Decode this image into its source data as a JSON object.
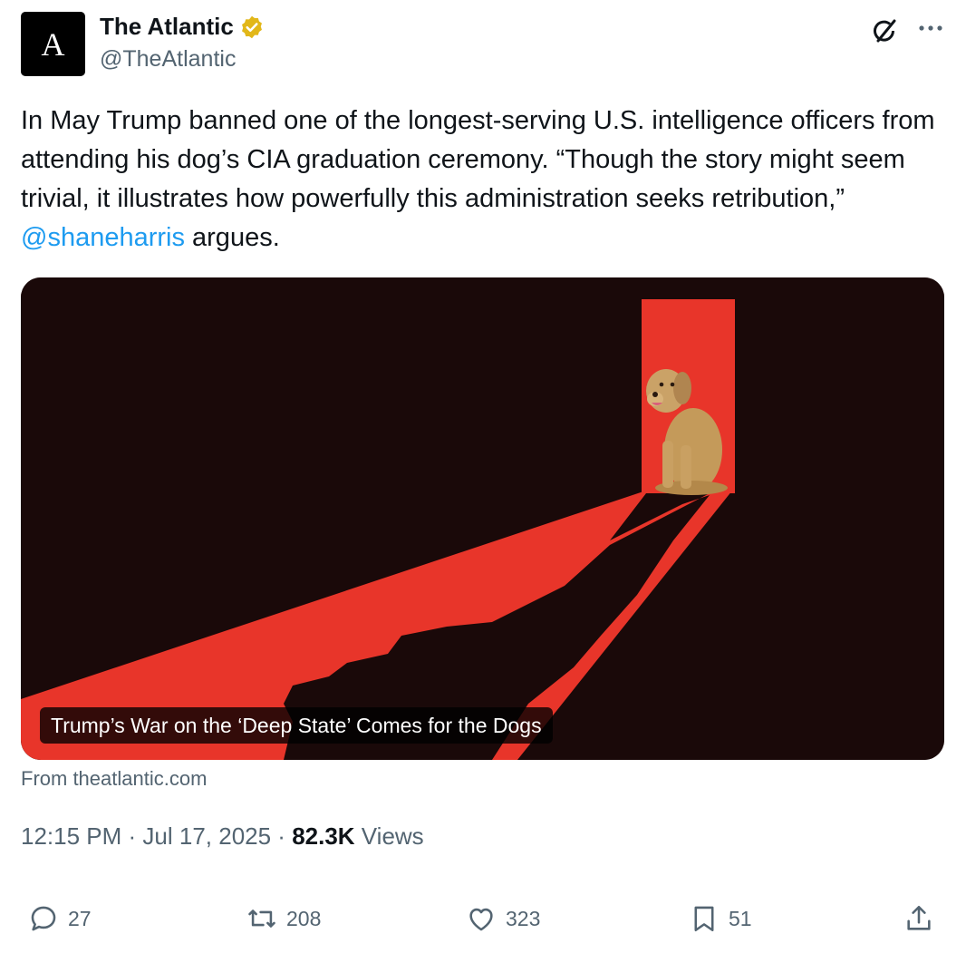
{
  "author": {
    "avatar_letter": "A",
    "display_name": "The Atlantic",
    "handle": "@TheAtlantic",
    "verified_color": "#e2b719"
  },
  "tweet": {
    "text_before": "In May Trump banned one of the longest-serving U.S. intelligence officers from attending his dog’s CIA graduation ceremony. “Though the story might seem trivial, it illustrates how powerfully this administration seeks retribution,” ",
    "mention": "@shaneharris",
    "text_after": " argues."
  },
  "card": {
    "title": "Trump’s War on the ‘Deep State’ Comes for the Dogs",
    "source": "From theatlantic.com",
    "colors": {
      "background": "#1a0909",
      "red": "#e8352a"
    }
  },
  "meta": {
    "time": "12:15 PM",
    "separator": " · ",
    "date": "Jul 17, 2025",
    "views_count": "82.3K",
    "views_label": " Views"
  },
  "actions": {
    "replies": "27",
    "reposts": "208",
    "likes": "323",
    "bookmarks": "51"
  },
  "icons": [
    "grok-icon",
    "more-icon",
    "verified-badge-icon",
    "reply-icon",
    "repost-icon",
    "like-icon",
    "bookmark-icon",
    "share-icon"
  ],
  "colors": {
    "link": "#1d9bf0",
    "muted": "#536471",
    "text": "#0f1419"
  }
}
